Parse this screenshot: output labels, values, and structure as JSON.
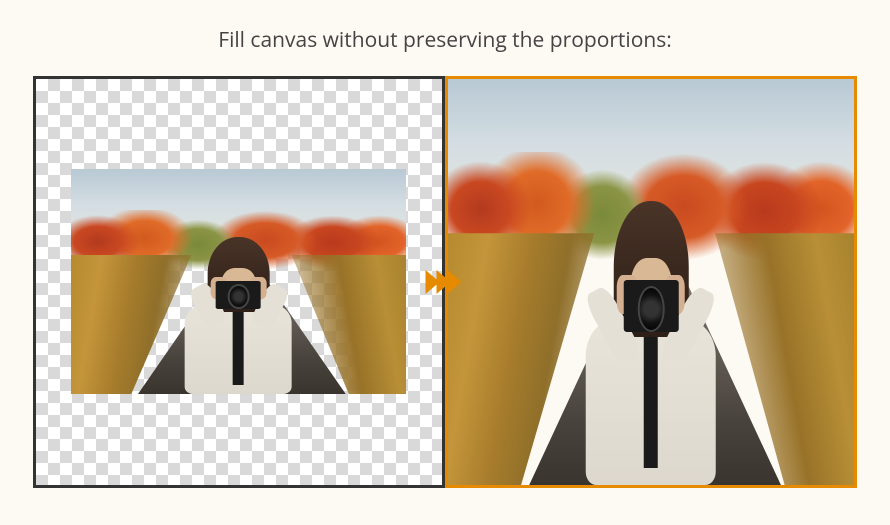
{
  "title": "Fill canvas without preserving the proportions:",
  "panels": {
    "left": {
      "border_color": "#333333",
      "description": "original-image-on-transparent-canvas"
    },
    "right": {
      "border_color": "#e68a00",
      "description": "image-stretched-to-fill-canvas"
    }
  },
  "arrow": {
    "color": "#e68a00",
    "chevron_count": 3
  },
  "image_subject": "person-with-camera-autumn-road"
}
